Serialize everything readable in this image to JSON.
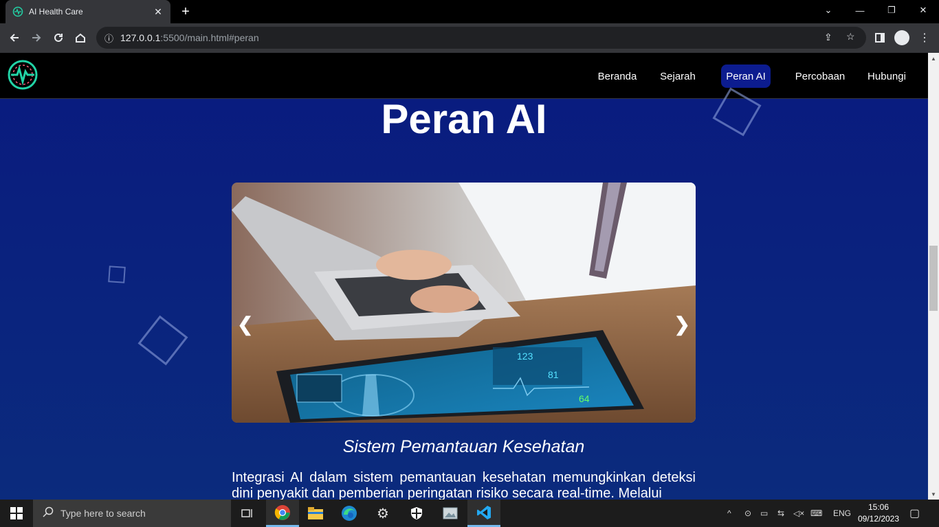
{
  "browser": {
    "tab_title": "AI Health Care",
    "url_host": "127.0.0.1",
    "url_path": ":5500/main.html#peran"
  },
  "nav": {
    "items": [
      {
        "label": "Beranda",
        "active": false
      },
      {
        "label": "Sejarah",
        "active": false
      },
      {
        "label": "Peran AI",
        "active": true
      },
      {
        "label": "Percobaan",
        "active": false
      },
      {
        "label": "Hubungi",
        "active": false
      }
    ]
  },
  "section": {
    "title": "Peran AI",
    "slide_caption": "Sistem Pemantauan Kesehatan",
    "paragraph": "Integrasi AI dalam sistem pemantauan kesehatan memungkinkan deteksi dini penyakit dan pemberian peringatan risiko secara real-time. Melalui",
    "prev_arrow": "❮",
    "next_arrow": "❯",
    "tablet_numbers": [
      "123",
      "81",
      "64"
    ]
  },
  "taskbar": {
    "search_placeholder": "Type here to search",
    "language": "ENG",
    "time": "15:06",
    "date": "09/12/2023"
  },
  "colors": {
    "page_bg": "#0a1d7a",
    "nav_active": "#0c1c8f",
    "logo_accent": "#22d3a6"
  }
}
